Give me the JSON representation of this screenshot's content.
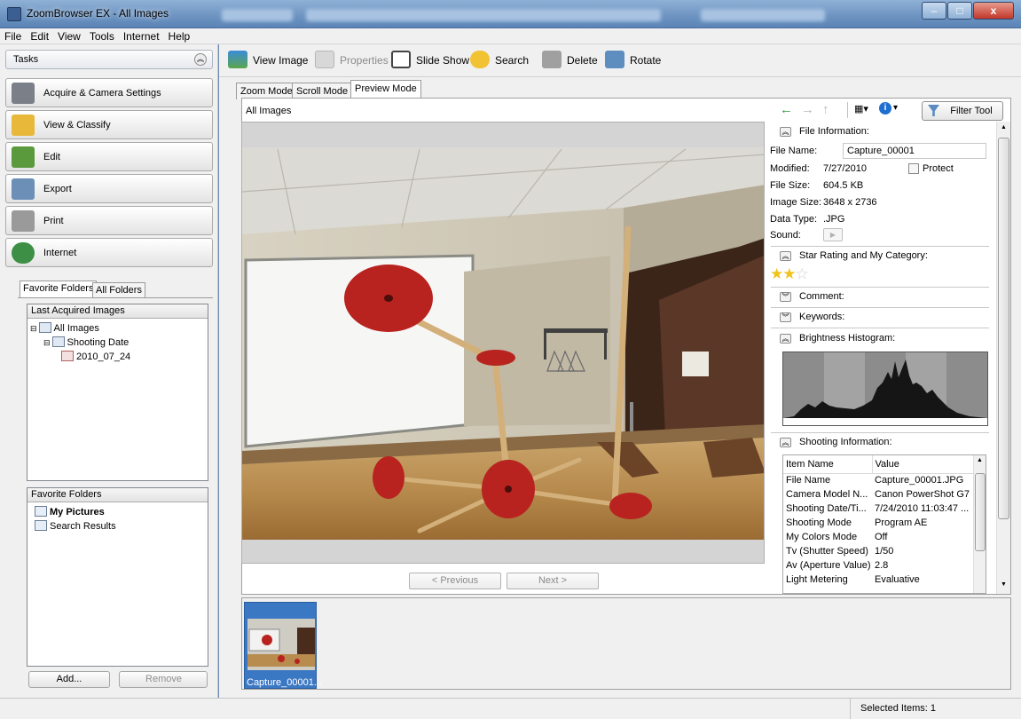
{
  "window": {
    "title": "ZoomBrowser EX  -  All Images",
    "min": "–",
    "max": "□",
    "close": "x"
  },
  "menu": [
    "File",
    "Edit",
    "View",
    "Tools",
    "Internet",
    "Help"
  ],
  "tasks": {
    "header": "Tasks",
    "items": [
      "Acquire & Camera Settings",
      "View & Classify",
      "Edit",
      "Export",
      "Print",
      "Internet"
    ]
  },
  "folder_tabs": [
    "Favorite Folders",
    "All Folders"
  ],
  "tree": {
    "header": "Last Acquired Images",
    "items": [
      "All Images",
      "Shooting Date",
      "2010_07_24"
    ]
  },
  "favorites": {
    "header": "Favorite Folders",
    "items": [
      "My Pictures",
      "Search Results"
    ],
    "add": "Add...",
    "remove": "Remove"
  },
  "toolbar": {
    "view": "View Image",
    "properties": "Properties",
    "slideshow": "Slide Show",
    "search": "Search",
    "delete": "Delete",
    "rotate": "Rotate"
  },
  "mode_tabs": [
    "Zoom Mode",
    "Scroll Mode",
    "Preview Mode"
  ],
  "breadcrumb": "All Images",
  "filter": "Filter Tool",
  "nav": {
    "prev": "< Previous",
    "next": "Next >"
  },
  "file_info": {
    "section": "File Information:",
    "name_label": "File Name:",
    "name": "Capture_00001",
    "modified_label": "Modified:",
    "modified": "7/27/2010",
    "protect": "Protect",
    "size_label": "File Size:",
    "size": "604.5 KB",
    "imgsize_label": "Image Size:",
    "imgsize": "3648 x 2736",
    "type_label": "Data Type:",
    "type": ".JPG",
    "sound_label": "Sound:"
  },
  "star": {
    "section": "Star Rating and My Category:",
    "rating": 2,
    "max": 3
  },
  "comment": "Comment:",
  "keywords": "Keywords:",
  "histogram": "Brightness Histogram:",
  "shooting": {
    "section": "Shooting Information:",
    "headers": [
      "Item Name",
      "Value"
    ],
    "rows": [
      [
        "File Name",
        "Capture_00001.JPG"
      ],
      [
        "Camera Model N...",
        "Canon PowerShot G7"
      ],
      [
        "Shooting Date/Ti...",
        "7/24/2010 11:03:47 ..."
      ],
      [
        "Shooting Mode",
        "Program AE"
      ],
      [
        "My Colors Mode",
        "Off"
      ],
      [
        "Tv (Shutter Speed)",
        "1/50"
      ],
      [
        "Av (Aperture Value)",
        "2.8"
      ],
      [
        "Light Metering",
        "Evaluative"
      ]
    ]
  },
  "thumbnail": {
    "label": "Capture_00001..."
  },
  "status": "Selected Items: 1",
  "colors": {
    "accent": "#3a7bd5",
    "toolbar_bg": "#f0f0f0",
    "selected_thumb": "#3b78c4"
  }
}
